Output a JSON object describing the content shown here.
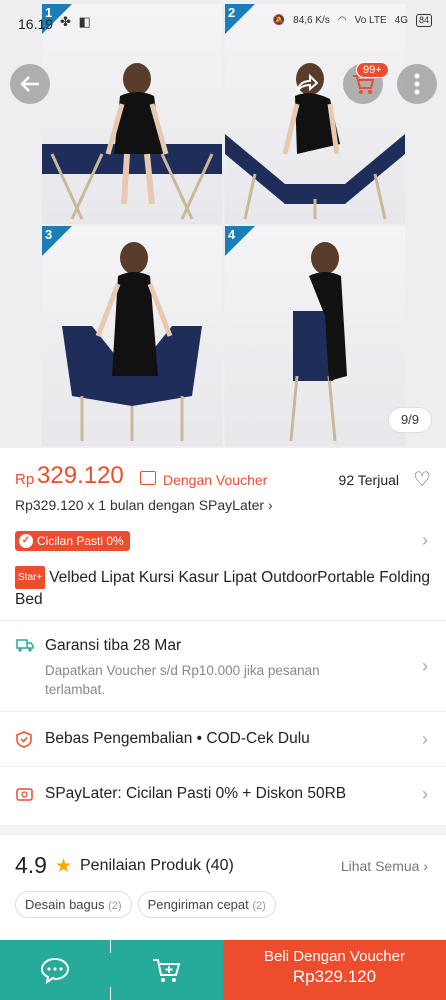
{
  "status_bar": {
    "time": "16.19",
    "left_icons": "✤ ◧",
    "network_speed": "84,6 K/s",
    "volte": "Vo LTE",
    "signal": "4G",
    "battery": "84"
  },
  "gallery": {
    "panels": [
      "1",
      "2",
      "3",
      "4"
    ],
    "counter": "9/9",
    "cart_badge": "99+"
  },
  "product": {
    "currency": "Rp",
    "price": "329.120",
    "voucher_label": "Dengan Voucher",
    "sold": "92 Terjual",
    "paylater": "Rp329.120 x 1 bulan dengan SPayLater",
    "cicilan_badge": "Cicilan Pasti 0%",
    "star_badge": "Star+",
    "title": "Velbed Lipat Kursi Kasur Lipat OutdoorPortable Folding Bed"
  },
  "rows": {
    "guarantee_title": "Garansi tiba 28 Mar",
    "guarantee_sub": "Dapatkan Voucher s/d Rp10.000 jika pesanan terlambat.",
    "returns": "Bebas Pengembalian",
    "cod": "COD-Cek Dulu",
    "spaylater": "SPayLater: Cicilan Pasti 0% + Diskon 50RB"
  },
  "rating": {
    "score": "4.9",
    "label": "Penilaian Produk",
    "count": "(40)",
    "see_all": "Lihat Semua",
    "tags": [
      {
        "label": "Desain bagus",
        "count": "(2)"
      },
      {
        "label": "Pengiriman cepat",
        "count": "(2)"
      }
    ]
  },
  "bottom_bar": {
    "buy_line1": "Beli Dengan Voucher",
    "buy_line2": "Rp329.120"
  },
  "colors": {
    "brand_orange": "#ee4d2d",
    "teal": "#26aa99",
    "star": "#f6a700",
    "corner_blue": "#1a7fb8"
  }
}
